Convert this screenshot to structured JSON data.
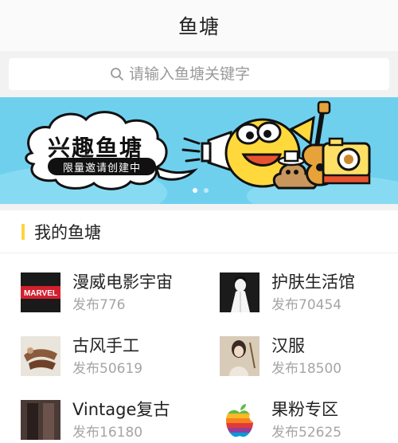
{
  "header": {
    "title": "鱼塘"
  },
  "search": {
    "placeholder": "请输入鱼塘关键字",
    "icon": "search-icon"
  },
  "banner": {
    "title": "兴趣鱼塘",
    "subtitle": "限量邀请创建中",
    "background": "#6fd0ee",
    "page_count": 2,
    "active_page": 1
  },
  "section": {
    "title": "我的鱼塘",
    "accent": "#ffd33d"
  },
  "ponds": [
    {
      "name": "漫威电影宇宙",
      "count": "发布776",
      "thumb": "marvel-logo"
    },
    {
      "name": "护肤生活馆",
      "count": "发布70454",
      "thumb": "fashion-illustration"
    },
    {
      "name": "古风手工",
      "count": "发布50619",
      "thumb": "craft-photo"
    },
    {
      "name": "汉服",
      "count": "发布18500",
      "thumb": "hanfu-photo"
    },
    {
      "name": "Vintage复古",
      "count": "发布16180",
      "thumb": "vintage-photo"
    },
    {
      "name": "果粉专区",
      "count": "发布52625",
      "thumb": "apple-logo"
    }
  ]
}
